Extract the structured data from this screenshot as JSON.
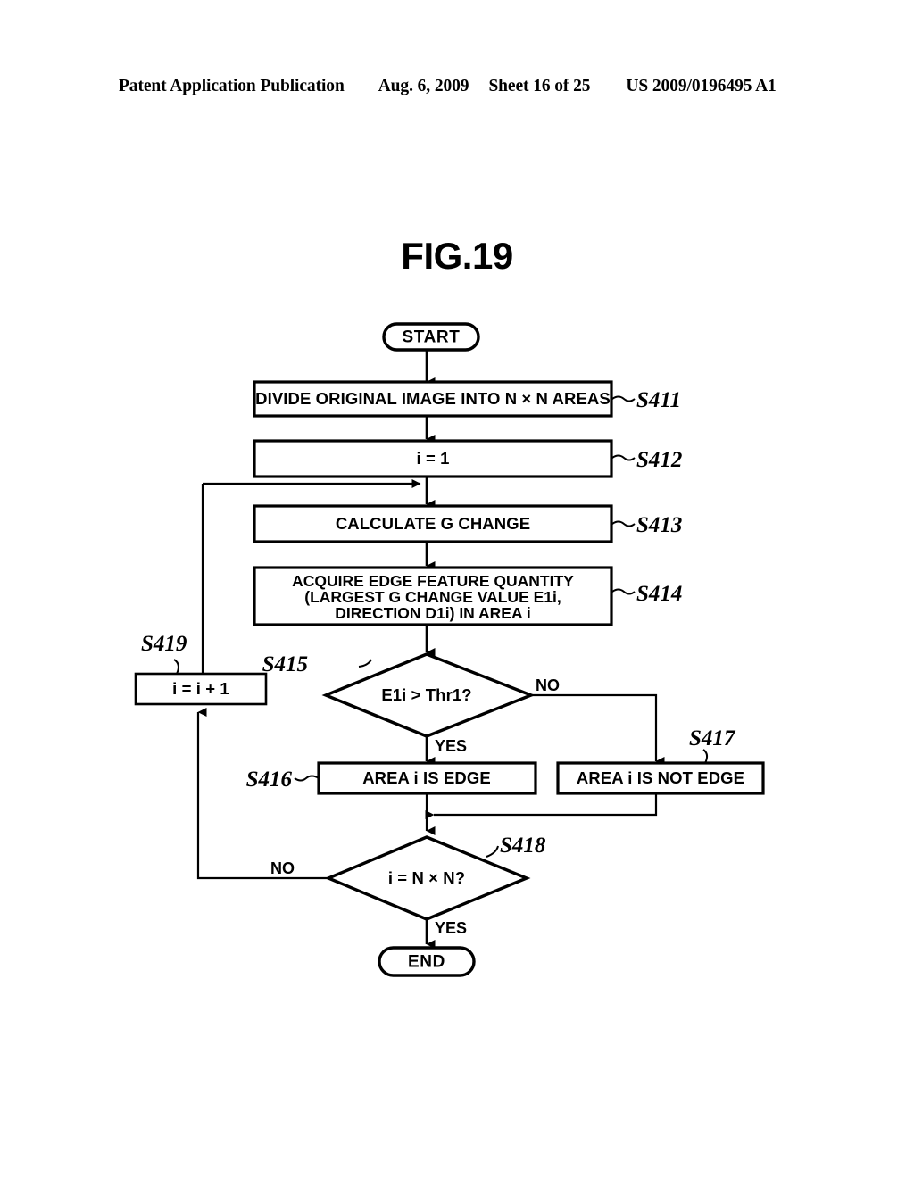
{
  "header": {
    "publication": "Patent Application Publication",
    "date": "Aug. 6, 2009",
    "sheet": "Sheet 16 of 25",
    "number": "US 2009/0196495 A1"
  },
  "figure": {
    "title": "FIG.19"
  },
  "flowchart": {
    "start": {
      "label": "START"
    },
    "end": {
      "label": "END"
    },
    "s411": {
      "text": "DIVIDE ORIGINAL IMAGE INTO N × N AREAS",
      "step": "S411"
    },
    "s412": {
      "text": "i = 1",
      "step": "S412"
    },
    "s413": {
      "text": "CALCULATE G CHANGE",
      "step": "S413"
    },
    "s414": {
      "line1": "ACQUIRE EDGE FEATURE QUANTITY",
      "line2": "(LARGEST G CHANGE VALUE E1i,",
      "line3": "DIRECTION D1i) IN AREA i",
      "step": "S414"
    },
    "s415": {
      "text": "E1i > Thr1?",
      "step": "S415",
      "yes_label": "YES",
      "no_label": "NO"
    },
    "s416": {
      "text": "AREA i IS EDGE",
      "step": "S416"
    },
    "s417": {
      "text": "AREA i IS NOT EDGE",
      "step": "S417"
    },
    "s418": {
      "text": "i = N × N?",
      "step": "S418",
      "yes_label": "YES",
      "no_label": "NO"
    },
    "s419": {
      "text": "i = i + 1",
      "step": "S419"
    }
  },
  "colors": {
    "ink": "#000000",
    "paper": "#ffffff"
  }
}
